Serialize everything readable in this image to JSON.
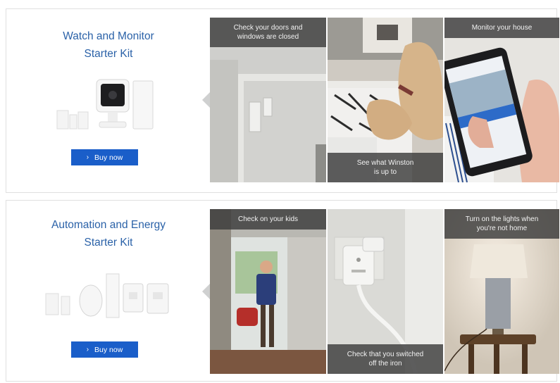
{
  "kits": [
    {
      "title": "Watch and Monitor\nStarter Kit",
      "button_label": "Buy now",
      "tiles": [
        {
          "caption": "Check your doors and\nwindows are closed",
          "position": "top",
          "image": "door-sensor-photo"
        },
        {
          "caption": "See what Winston\nis up to",
          "position": "bottom",
          "image": "dog-photo"
        },
        {
          "caption": "Monitor your house",
          "position": "top",
          "image": "phone-app-photo"
        }
      ]
    },
    {
      "title": "Automation and Energy\nStarter Kit",
      "button_label": "Buy now",
      "tiles": [
        {
          "caption": "Check on your kids",
          "position": "top",
          "image": "child-doorway-photo"
        },
        {
          "caption": "Check that you switched\noff the iron",
          "position": "bottom",
          "image": "smart-plug-photo"
        },
        {
          "caption": "Turn on the lights when\nyou're not home",
          "position": "top",
          "image": "lamp-photo"
        }
      ]
    }
  ],
  "colors": {
    "accent": "#2b62a8",
    "button": "#1a5ec9",
    "caption_bg": "#3c3c3c"
  }
}
